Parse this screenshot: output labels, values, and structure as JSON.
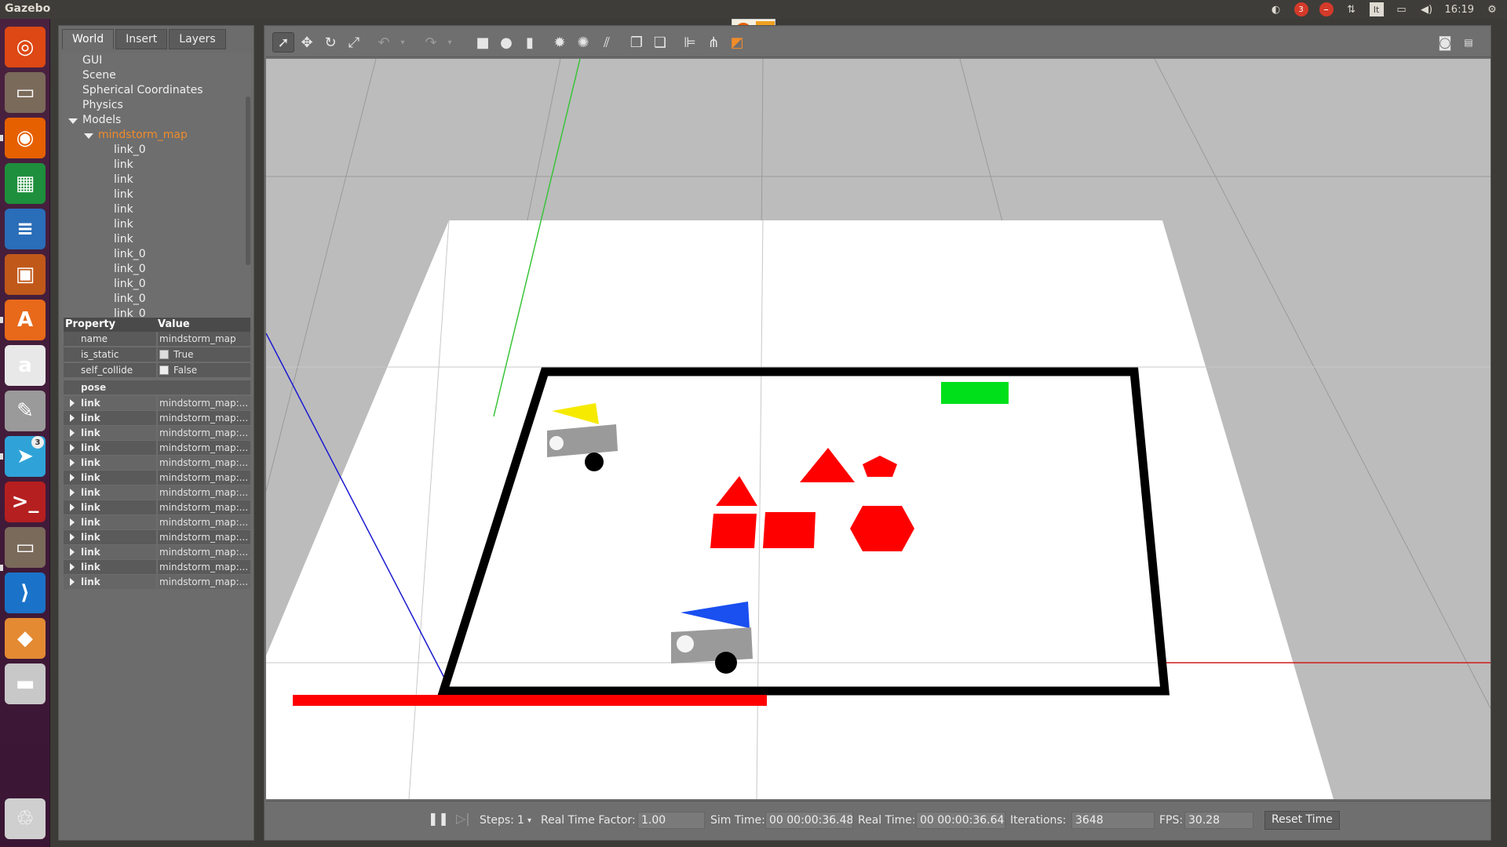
{
  "window": {
    "title": "Gazebo"
  },
  "tray": {
    "clock": "16:19",
    "badge_count": "3",
    "keyboard": "It"
  },
  "launcher": {
    "apps": [
      {
        "name": "ubuntu-dash",
        "color": "#dd4814",
        "glyph": "◎"
      },
      {
        "name": "files",
        "color": "#7a6a5a",
        "glyph": "▭"
      },
      {
        "name": "firefox",
        "color": "#e66000",
        "glyph": "◉"
      },
      {
        "name": "libreoffice-calc",
        "color": "#1e8f3c",
        "glyph": "▦"
      },
      {
        "name": "libreoffice-writer",
        "color": "#2a6db8",
        "glyph": "≡"
      },
      {
        "name": "libreoffice-impress",
        "color": "#c0581a",
        "glyph": "▣"
      },
      {
        "name": "software-center",
        "color": "#e8691a",
        "glyph": "A"
      },
      {
        "name": "amazon",
        "color": "#e8e8e8",
        "glyph": "a"
      },
      {
        "name": "system-settings",
        "color": "#9a9a9a",
        "glyph": "✎"
      },
      {
        "name": "telegram",
        "color": "#2fa3d8",
        "glyph": "➤",
        "badge": "3"
      },
      {
        "name": "terminal",
        "color": "#b51f1f",
        "glyph": ">_"
      },
      {
        "name": "files-2",
        "color": "#7a6a5a",
        "glyph": "▭"
      },
      {
        "name": "vscode",
        "color": "#1a73c8",
        "glyph": "⟩"
      },
      {
        "name": "gazebo",
        "color": "#e38a33",
        "glyph": "◆"
      },
      {
        "name": "disk",
        "color": "#c8c8c8",
        "glyph": "▬"
      },
      {
        "name": "trash",
        "color": "#cfcfcf",
        "glyph": "♲"
      }
    ]
  },
  "left_panel": {
    "tabs": [
      {
        "label": "World",
        "active": true
      },
      {
        "label": "Insert",
        "active": false
      },
      {
        "label": "Layers",
        "active": false
      }
    ],
    "tree": {
      "roots": [
        "GUI",
        "Scene",
        "Spherical Coordinates",
        "Physics",
        "Models"
      ],
      "model": "mindstorm_map",
      "children": [
        "link_0",
        "link",
        "link",
        "link",
        "link",
        "link",
        "link",
        "link_0",
        "link_0",
        "link_0",
        "link_0",
        "link_0"
      ]
    },
    "properties": {
      "header_property": "Property",
      "header_value": "Value",
      "name_key": "name",
      "name_value": "mindstorm_map",
      "is_static_key": "is_static",
      "is_static_value": "True",
      "self_collide_key": "self_collide",
      "self_collide_value": "False",
      "pose_key": "pose",
      "link_key": "link",
      "link_value": "mindstorm_map:...",
      "link_rows": 13
    }
  },
  "bottom_bar": {
    "steps_label": "Steps:",
    "steps_value": "1",
    "rtf_label": "Real Time Factor:",
    "rtf_value": "1.00",
    "sim_time_label": "Sim Time:",
    "sim_time_value": "00 00:00:36.480",
    "real_time_label": "Real Time:",
    "real_time_value": "00 00:00:36.641",
    "iterations_label": "Iterations:",
    "iterations_value": "3648",
    "fps_label": "FPS:",
    "fps_value": "30.28",
    "reset_label": "Reset Time"
  },
  "colors": {
    "accent_orange": "#f08c2a",
    "shape_red": "#ff0000",
    "goal_green": "#00e01a",
    "robot_yellow": "#f6ea00",
    "robot_blue": "#1a4ff0"
  }
}
